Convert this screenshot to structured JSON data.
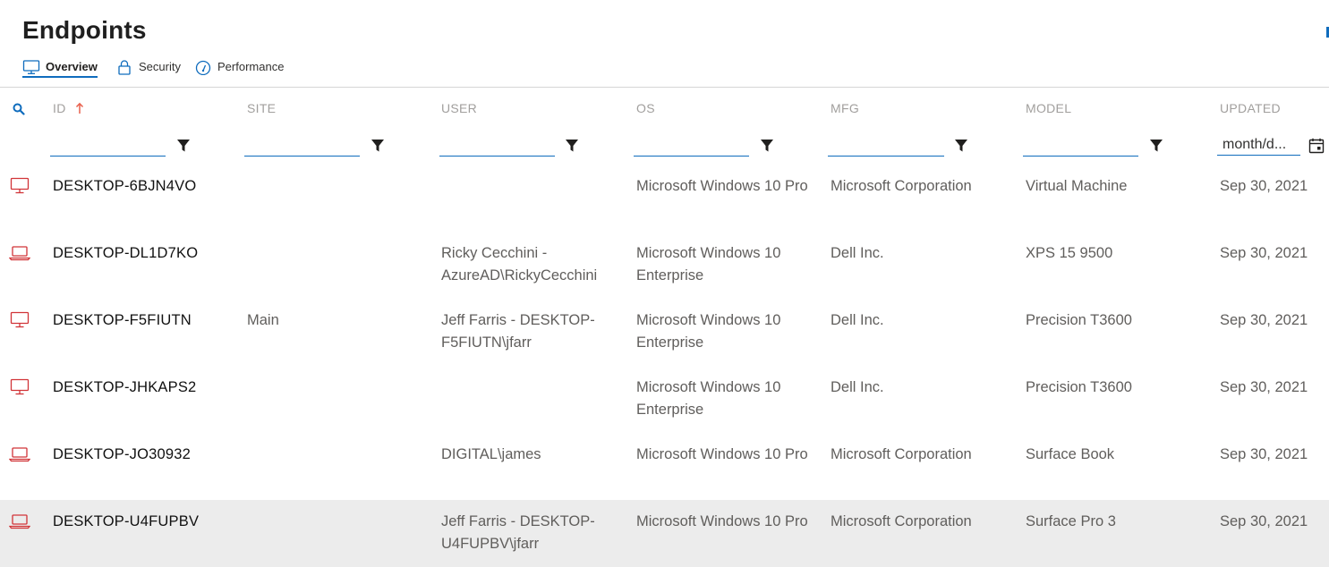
{
  "page": {
    "title": "Endpoints"
  },
  "tabs": [
    {
      "label": "Overview",
      "icon": "monitor-icon",
      "active": true
    },
    {
      "label": "Security",
      "icon": "lock-icon",
      "active": false
    },
    {
      "label": "Performance",
      "icon": "gauge-icon",
      "active": false
    }
  ],
  "columns": {
    "id": "ID",
    "site": "SITE",
    "user": "USER",
    "os": "OS",
    "mfg": "MFG",
    "model": "MODEL",
    "updated": "UPDATED"
  },
  "filters": {
    "id": "",
    "site": "",
    "user": "",
    "os": "",
    "mfg": "",
    "model": "",
    "updated_placeholder": "month/d..."
  },
  "colors": {
    "accent": "#0f6cbd",
    "device_icon": "#d13438",
    "sort_arrow": "#e8604c",
    "selected_row": "#ececec"
  },
  "rows": [
    {
      "device": "desktop-icon",
      "id": "DESKTOP-6BJN4VO",
      "site": "",
      "user": "",
      "os": "Microsoft Windows 10 Pro",
      "mfg": "Microsoft Corporation",
      "model": "Virtual Machine",
      "updated": "Sep 30, 2021"
    },
    {
      "device": "laptop-icon",
      "id": "DESKTOP-DL1D7KO",
      "site": "",
      "user": "Ricky Cecchini - AzureAD\\RickyCecchini",
      "os": "Microsoft Windows 10 Enterprise",
      "mfg": "Dell Inc.",
      "model": "XPS 15 9500",
      "updated": "Sep 30, 2021"
    },
    {
      "device": "desktop-icon",
      "id": "DESKTOP-F5FIUTN",
      "site": "Main",
      "user": "Jeff Farris - DESKTOP-F5FIUTN\\jfarr",
      "os": "Microsoft Windows 10 Enterprise",
      "mfg": "Dell Inc.",
      "model": "Precision T3600",
      "updated": "Sep 30, 2021"
    },
    {
      "device": "desktop-icon",
      "id": "DESKTOP-JHKAPS2",
      "site": "",
      "user": "",
      "os": "Microsoft Windows 10 Enterprise",
      "mfg": "Dell Inc.",
      "model": "Precision T3600",
      "updated": "Sep 30, 2021"
    },
    {
      "device": "laptop-icon",
      "id": "DESKTOP-JO30932",
      "site": "",
      "user": "DIGITAL\\james",
      "os": "Microsoft Windows 10 Pro",
      "mfg": "Microsoft Corporation",
      "model": "Surface Book",
      "updated": "Sep 30, 2021"
    },
    {
      "device": "laptop-icon",
      "id": "DESKTOP-U4FUPBV",
      "site": "",
      "user": "Jeff Farris - DESKTOP-U4FUPBV\\jfarr",
      "os": "Microsoft Windows 10 Pro",
      "mfg": "Microsoft Corporation",
      "model": "Surface Pro 3",
      "updated": "Sep 30, 2021",
      "selected": true
    }
  ]
}
